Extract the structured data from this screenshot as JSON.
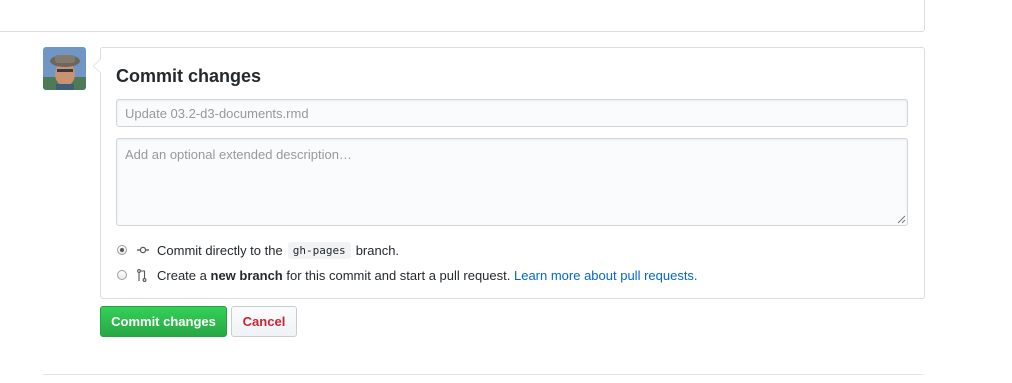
{
  "commit": {
    "title": "Commit changes",
    "summary_placeholder": "Update 03.2-d3-documents.rmd",
    "description_placeholder": "Add an optional extended description…"
  },
  "options": {
    "direct": {
      "prefix": "Commit directly to the",
      "branch": "gh-pages",
      "suffix": "branch.",
      "selected": true,
      "icon": "git-commit-icon"
    },
    "new_branch": {
      "prefix": "Create a",
      "bold": "new branch",
      "middle": "for this commit and start a pull request.",
      "link": "Learn more about pull requests.",
      "selected": false,
      "icon": "git-pull-request-icon"
    }
  },
  "buttons": {
    "commit": "Commit changes",
    "cancel": "Cancel"
  },
  "colors": {
    "primary": "#28a745",
    "danger": "#cb2431",
    "link": "#0366d6"
  }
}
